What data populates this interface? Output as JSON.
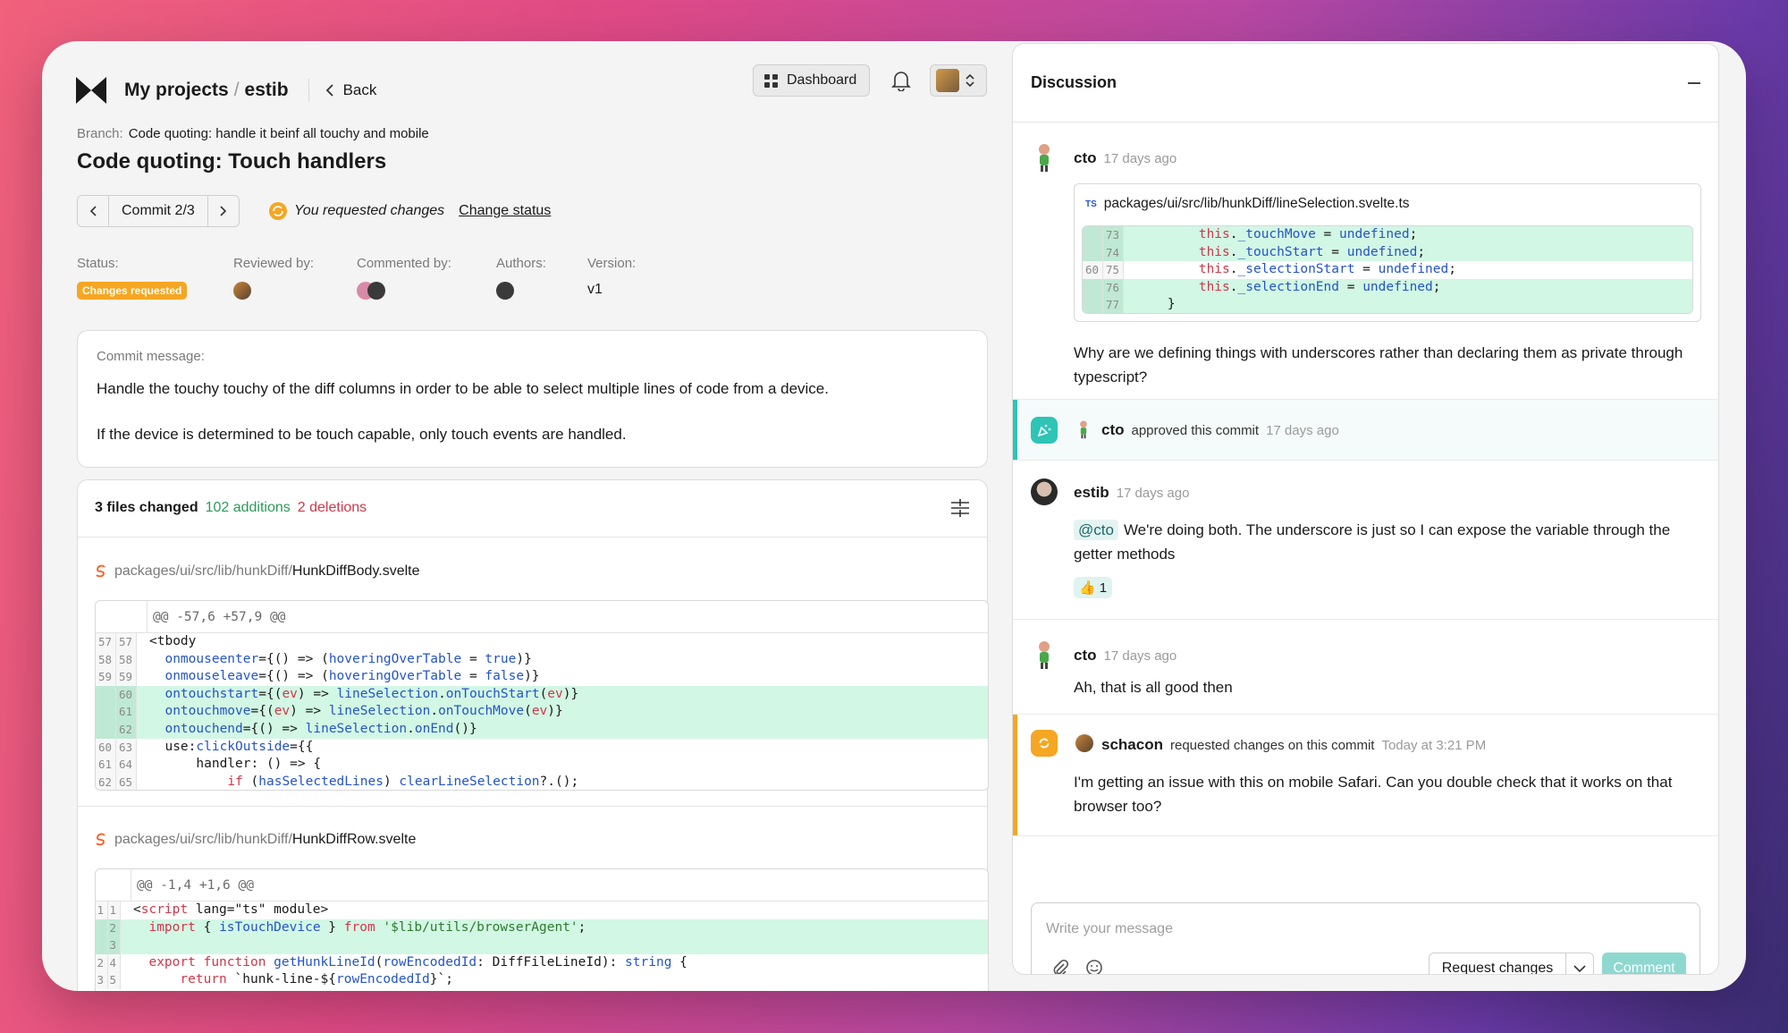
{
  "header": {
    "project_root": "My projects",
    "separator": "/",
    "project": "estib",
    "back_label": "Back",
    "dashboard_label": "Dashboard"
  },
  "branch": {
    "label": "Branch:",
    "name": "Code quoting: handle it beinf all touchy and mobile"
  },
  "title": "Code quoting: Touch handlers",
  "commit_nav": {
    "label": "Commit 2/3"
  },
  "review_status": {
    "text": "You requested changes",
    "action": "Change status"
  },
  "meta": {
    "status_label": "Status:",
    "status_value": "Changes requested",
    "reviewed_label": "Reviewed by:",
    "commented_label": "Commented by:",
    "authors_label": "Authors:",
    "version_label": "Version:",
    "version_value": "v1"
  },
  "commit_message": {
    "label": "Commit message:",
    "line1": "Handle the touchy touchy of the diff columns in order to be able to select multiple lines of code from a device.",
    "line2": "If the device is determined to be touch capable, only touch events are handled."
  },
  "files": {
    "summary": "3 files changed",
    "additions": "102 additions",
    "deletions": "2 deletions",
    "file1": {
      "dir": "packages/ui/src/lib/hunkDiff/",
      "name": "HunkDiffBody.svelte",
      "hunk": "@@ -57,6 +57,9 @@"
    },
    "file2": {
      "dir": "packages/ui/src/lib/hunkDiff/",
      "name": "HunkDiffRow.svelte",
      "hunk": "@@ -1,4 +1,6 @@"
    }
  },
  "colors": {
    "accent": "#2ec4b6",
    "warning": "#f5a623",
    "added_bg": "#d2f7e4",
    "keyword": "#d0384a",
    "function": "#2454c9"
  },
  "discussion": {
    "title": "Discussion",
    "c1": {
      "author": "cto",
      "time": "17 days ago",
      "file": "packages/ui/src/lib/hunkDiff/lineSelection.svelte.ts",
      "file_badge": "TS",
      "text": "Why are we defining things with underscores rather than declaring them as private through typescript?"
    },
    "c2": {
      "author": "cto",
      "action": "approved this commit",
      "time": "17 days ago"
    },
    "c3": {
      "author": "estib",
      "time": "17 days ago",
      "mention": "@cto",
      "text": "We're doing both. The underscore is just so I can expose the variable through the getter methods",
      "reaction_emoji": "👍",
      "reaction_count": "1"
    },
    "c4": {
      "author": "cto",
      "time": "17 days ago",
      "text": "Ah, that is all good then"
    },
    "c5": {
      "author": "schacon",
      "action": "requested changes on this commit",
      "time": "Today at 3:21 PM",
      "text": "I'm getting an issue with this on mobile Safari. Can you double check that it works on that browser too?"
    }
  },
  "composer": {
    "placeholder": "Write your message",
    "request_changes": "Request changes",
    "comment": "Comment"
  }
}
